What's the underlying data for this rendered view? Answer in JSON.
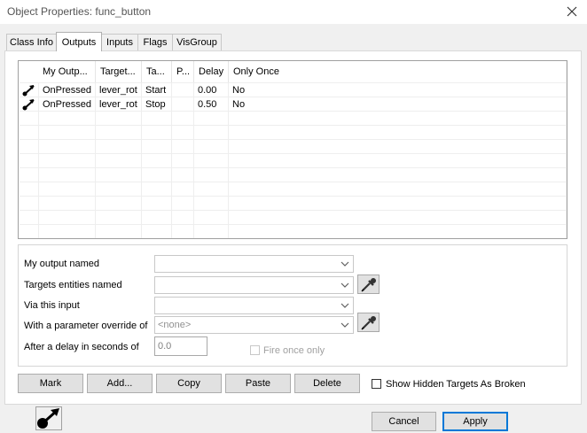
{
  "window": {
    "title": "Object Properties: func_button"
  },
  "tabs": [
    {
      "label": "Class Info"
    },
    {
      "label": "Outputs"
    },
    {
      "label": "Inputs"
    },
    {
      "label": "Flags"
    },
    {
      "label": "VisGroup"
    }
  ],
  "active_tab": "Outputs",
  "outputs_list": {
    "columns": [
      "My Outp...",
      "Target...",
      "Ta...",
      "P...",
      "Delay",
      "Only Once"
    ],
    "rows": [
      {
        "icon": "output-connection-icon",
        "cells": [
          "OnPressed",
          "lever_rot",
          "Start",
          "",
          "0.00",
          "No"
        ]
      },
      {
        "icon": "output-connection-icon",
        "cells": [
          "OnPressed",
          "lever_rot",
          "Stop",
          "",
          "0.50",
          "No"
        ]
      }
    ]
  },
  "form": {
    "output_label": "My output named",
    "output_value": "",
    "target_label": "Targets entities named",
    "target_value": "",
    "input_label": "Via this input",
    "input_value": "",
    "param_label": "With a parameter override of",
    "param_value": "<none>",
    "delay_label": "After a delay in seconds of",
    "delay_value": "0.0",
    "fire_once_label": "Fire once only"
  },
  "buttons": {
    "mark": "Mark",
    "add": "Add...",
    "copy": "Copy",
    "paste": "Paste",
    "delete": "Delete",
    "cancel": "Cancel",
    "apply": "Apply"
  },
  "show_hidden_label": "Show Hidden Targets As Broken",
  "colors": {
    "accent_border": "#0078d7",
    "window_bg": "#f0f0f0",
    "button_face": "#e1e1e1",
    "disabled_text": "#a0a0a0"
  }
}
